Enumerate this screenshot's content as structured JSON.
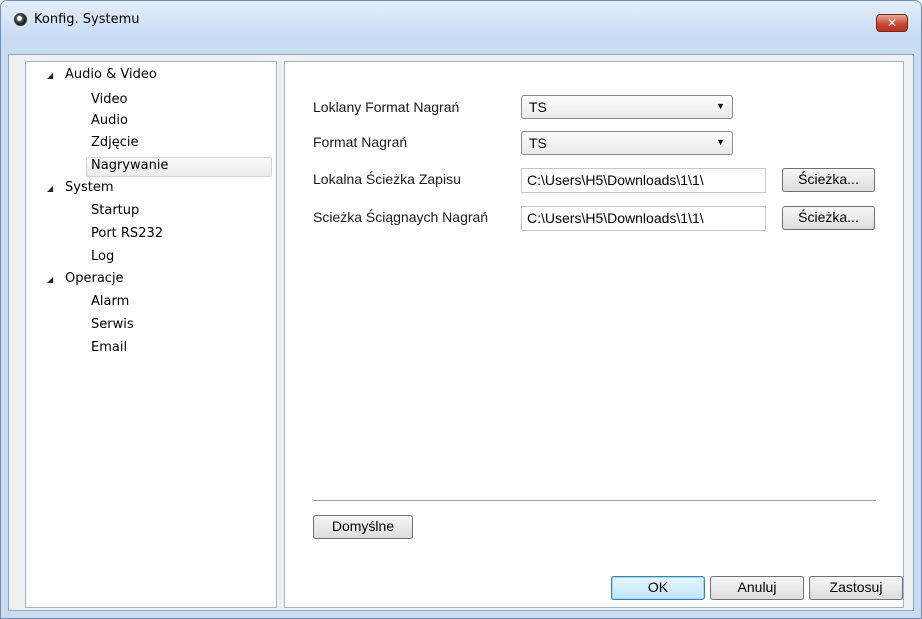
{
  "window": {
    "title": "Konfig. Systemu",
    "close_glyph": "✕"
  },
  "tree": {
    "groups": [
      {
        "label": "Audio & Video",
        "items": [
          "Video",
          "Audio",
          "Zdjęcie",
          "Nagrywanie"
        ]
      },
      {
        "label": "System",
        "items": [
          "Startup",
          "Port RS232",
          "Log"
        ]
      },
      {
        "label": "Operacje",
        "items": [
          "Alarm",
          "Serwis",
          "Email"
        ]
      }
    ],
    "selected": "Nagrywanie"
  },
  "form": {
    "local_format_label": "Loklany Format Nagrań",
    "local_format_value": "TS",
    "format_label": "Format Nagrań",
    "format_value": "TS",
    "local_path_label": "Lokalna Ścieżka Zapisu",
    "local_path_value": "C:\\Users\\H5\\Downloads\\1\\1\\",
    "local_path_button": "Ścieżka...",
    "download_path_label": "Scieżka Ściągnaych Nagrań",
    "download_path_value": "C:\\Users\\H5\\Downloads\\1\\1\\",
    "download_path_button": "Ścieżka..."
  },
  "buttons": {
    "defaults": "Domyślne",
    "ok": "OK",
    "cancel": "Anuluj",
    "apply": "Zastosuj"
  },
  "icons": {
    "app": "app-icon",
    "close": "close-icon",
    "expanded": "expanded-caret-icon",
    "dropdown": "chevron-down-icon"
  }
}
